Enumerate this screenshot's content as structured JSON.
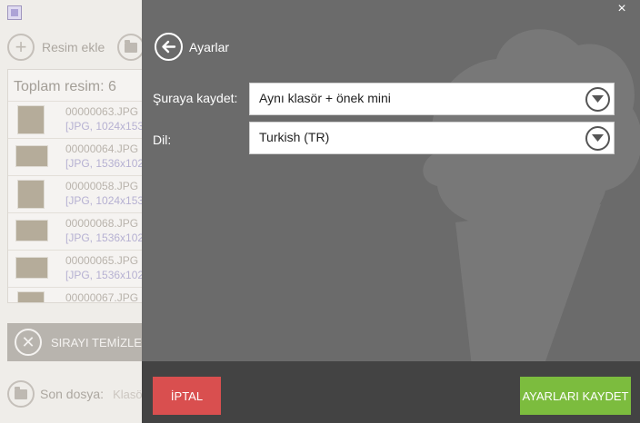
{
  "background": {
    "toolbar": {
      "add_label": "Resim ekle"
    },
    "list": {
      "count_label": "Toplam resim: 6",
      "items": [
        {
          "name": "00000063.JPG",
          "meta": "[JPG, 1024x153"
        },
        {
          "name": "00000064.JPG",
          "meta": "[JPG, 1536x102"
        },
        {
          "name": "00000058.JPG",
          "meta": "[JPG, 1024x153"
        },
        {
          "name": "00000068.JPG",
          "meta": "[JPG, 1536x102"
        },
        {
          "name": "00000065.JPG",
          "meta": "[JPG, 1536x102"
        },
        {
          "name": "00000067.JPG",
          "meta": ""
        }
      ]
    },
    "clear_label": "SIRAYI TEMİZLE",
    "last_file": {
      "label": "Son dosya:",
      "value": "Klasö"
    }
  },
  "settings": {
    "title": "Ayarlar",
    "close_glyph": "×",
    "fields": {
      "save_to": {
        "label": "Şuraya kaydet:",
        "value": "Aynı klasör + önek mini"
      },
      "language": {
        "label": "Dil:",
        "value": "Turkish (TR)"
      }
    },
    "cancel_label": "İPTAL",
    "save_label": "AYARLARI KAYDET"
  },
  "colors": {
    "panel_bg": "#6b6b6b",
    "footer_bg": "#434343",
    "cancel": "#d94f4f",
    "save": "#7cbc3e"
  },
  "icons": {
    "back": "arrow-left-icon",
    "dropdown": "chevron-down-icon",
    "close": "close-icon",
    "watermark": "ice-cream-icon"
  }
}
